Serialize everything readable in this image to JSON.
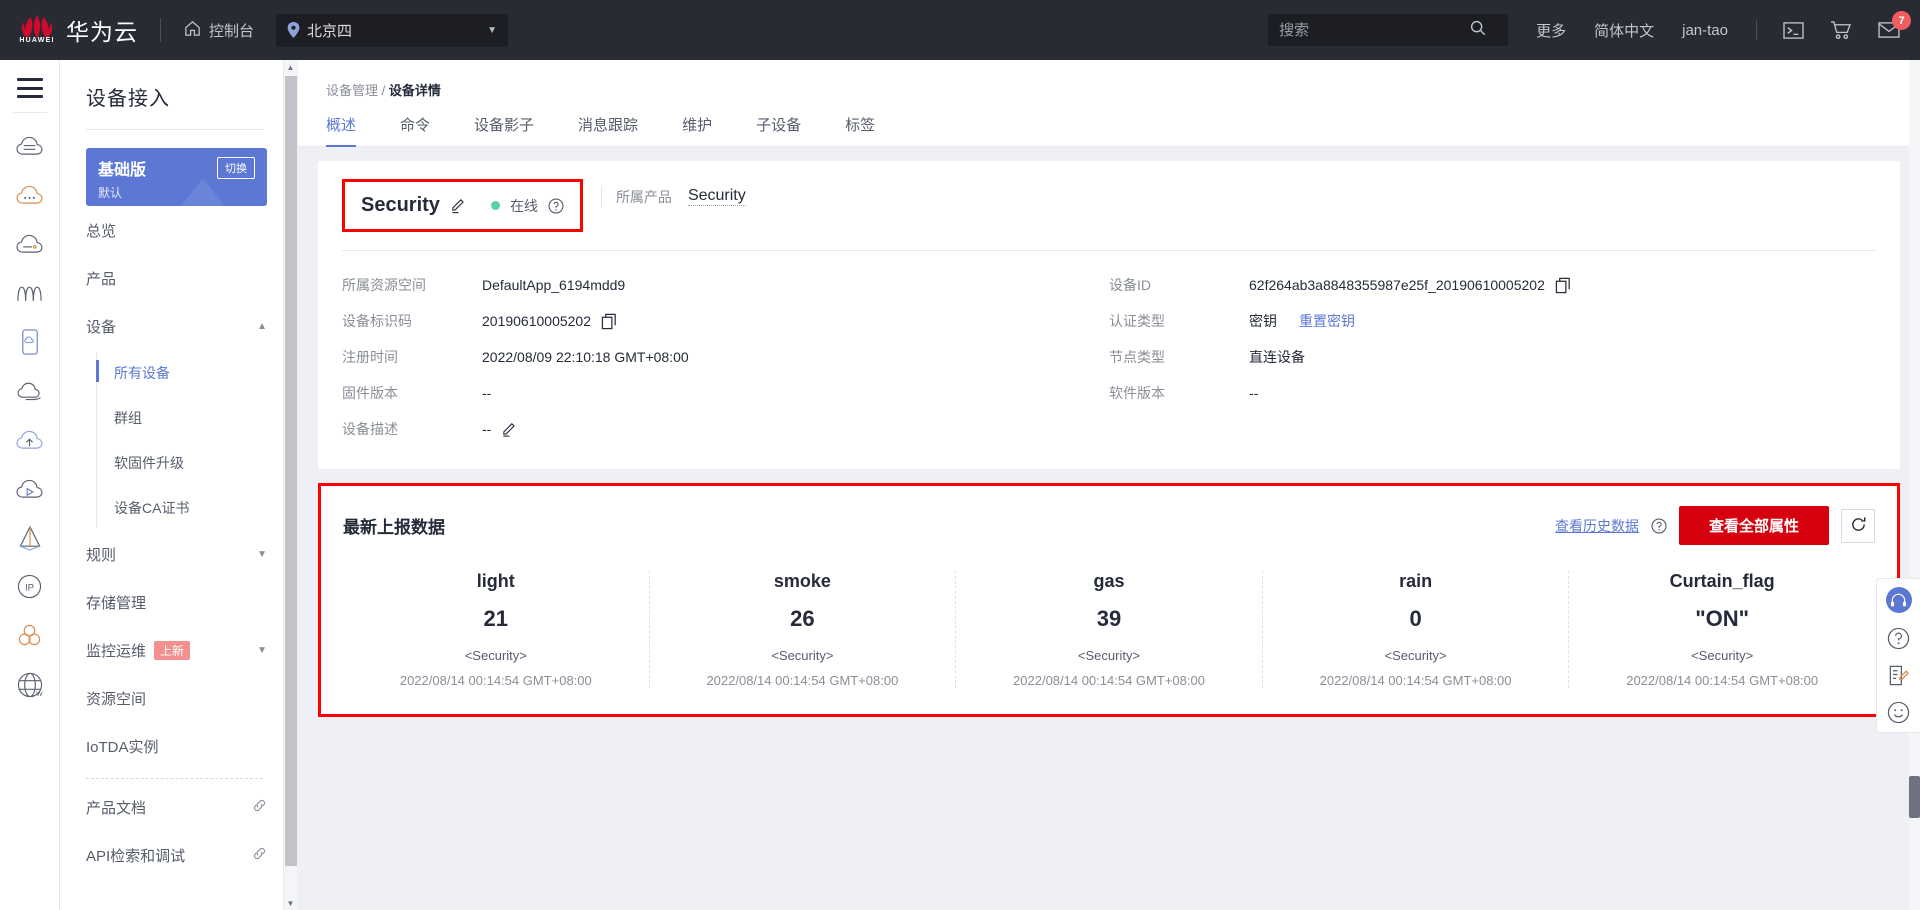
{
  "header": {
    "brand": "华为云",
    "brand_word": "HUAWEI",
    "console_label": "控制台",
    "home_icon": "home-icon",
    "region": "北京四",
    "region_icon": "location-pin-icon",
    "search_placeholder": "搜索",
    "search_value": "",
    "search_icon": "search-icon",
    "more_label": "更多",
    "lang_label": "简体中文",
    "user_label": "jan-tao",
    "terminal_icon": "terminal-icon",
    "cart_icon": "shopping-cart-icon",
    "mail_icon": "mail-icon",
    "mail_badge": "7"
  },
  "rail": {
    "menu_icon": "hamburger-menu-icon",
    "items": [
      {
        "icon": "cloud-server-icon"
      },
      {
        "icon": "cloud-dots-icon"
      },
      {
        "icon": "cloud-storage-icon"
      },
      {
        "icon": "wave-analytics-icon"
      },
      {
        "icon": "mobile-cloud-icon"
      },
      {
        "icon": "cloud-stack-icon"
      },
      {
        "icon": "cloud-upload-icon"
      },
      {
        "icon": "cloud-play-icon"
      },
      {
        "icon": "pyramid-icon"
      },
      {
        "icon": "ip-circle-icon"
      },
      {
        "icon": "cluster-nodes-icon"
      },
      {
        "icon": "globe-web-icon"
      }
    ]
  },
  "sidebar": {
    "title": "设备接入",
    "edition": {
      "name": "基础版",
      "switch_label": "切换",
      "sub": "默认"
    },
    "nav": [
      {
        "label": "总览",
        "type": "item"
      },
      {
        "label": "产品",
        "type": "item"
      },
      {
        "label": "设备",
        "type": "group",
        "expanded": true,
        "chevron": "chevron-up-icon"
      }
    ],
    "device_children": [
      {
        "label": "所有设备",
        "active": true
      },
      {
        "label": "群组",
        "active": false
      },
      {
        "label": "软固件升级",
        "active": false
      },
      {
        "label": "设备CA证书",
        "active": false
      }
    ],
    "nav2": [
      {
        "label": "规则",
        "type": "group",
        "chevron": "chevron-down-icon"
      },
      {
        "label": "存储管理",
        "type": "item"
      },
      {
        "label": "监控运维",
        "type": "group",
        "badge": "上新",
        "chevron": "chevron-down-icon"
      },
      {
        "label": "资源空间",
        "type": "item"
      },
      {
        "label": "IoTDA实例",
        "type": "item"
      }
    ],
    "external": [
      {
        "label": "产品文档",
        "icon": "external-link-icon"
      },
      {
        "label": "API检索和调试",
        "icon": "external-link-icon"
      }
    ],
    "scroll_up_icon": "scroll-up-arrow-icon",
    "scroll_down_icon": "scroll-down-arrow-icon"
  },
  "breadcrumb": {
    "parent": "设备管理",
    "separator": "/",
    "current": "设备详情"
  },
  "tabs": [
    {
      "label": "概述",
      "active": true
    },
    {
      "label": "命令",
      "active": false
    },
    {
      "label": "设备影子",
      "active": false
    },
    {
      "label": "消息跟踪",
      "active": false
    },
    {
      "label": "维护",
      "active": false
    },
    {
      "label": "子设备",
      "active": false
    },
    {
      "label": "标签",
      "active": false
    }
  ],
  "device": {
    "name": "Security",
    "edit_icon": "pencil-edit-icon",
    "status_text": "在线",
    "status_color": "#5ad2a4",
    "help_icon": "question-circle-icon",
    "product_label": "所属产品",
    "product_name": "Security",
    "highlight_color": "#fd0000",
    "left_fields": [
      {
        "key": "所属资源空间",
        "value": "DefaultApp_6194mdd9",
        "copy": false,
        "edit": false
      },
      {
        "key": "设备标识码",
        "value": "20190610005202",
        "copy": true,
        "edit": false
      },
      {
        "key": "注册时间",
        "value": "2022/08/09 22:10:18 GMT+08:00",
        "copy": false,
        "edit": false
      },
      {
        "key": "固件版本",
        "value": "--",
        "copy": false,
        "edit": false
      },
      {
        "key": "设备描述",
        "value": "--",
        "copy": false,
        "edit": true
      }
    ],
    "right_fields": [
      {
        "key": "设备ID",
        "value": "62f264ab3a8848355987e25f_20190610005202",
        "copy": true,
        "link": ""
      },
      {
        "key": "认证类型",
        "value": "密钥",
        "copy": false,
        "link": "重置密钥"
      },
      {
        "key": "节点类型",
        "value": "直连设备",
        "copy": false,
        "link": ""
      },
      {
        "key": "软件版本",
        "value": "--",
        "copy": false,
        "link": ""
      }
    ]
  },
  "data_card": {
    "title": "最新上报数据",
    "history_link": "查看历史数据",
    "help_icon": "question-circle-icon",
    "all_props_button": "查看全部属性",
    "refresh_icon": "refresh-icon",
    "button_color": "#d7000f",
    "metrics": [
      {
        "name": "light",
        "value": "21",
        "source": "<Security>",
        "time": "2022/08/14 00:14:54 GMT+08:00"
      },
      {
        "name": "smoke",
        "value": "26",
        "source": "<Security>",
        "time": "2022/08/14 00:14:54 GMT+08:00"
      },
      {
        "name": "gas",
        "value": "39",
        "source": "<Security>",
        "time": "2022/08/14 00:14:54 GMT+08:00"
      },
      {
        "name": "rain",
        "value": "0",
        "source": "<Security>",
        "time": "2022/08/14 00:14:54 GMT+08:00"
      },
      {
        "name": "Curtain_flag",
        "value": "\"ON\"",
        "source": "<Security>",
        "time": "2022/08/14 00:14:54 GMT+08:00"
      }
    ]
  },
  "float_panel": [
    {
      "icon": "headset-support-icon"
    },
    {
      "icon": "question-circle-icon"
    },
    {
      "icon": "feedback-form-icon"
    },
    {
      "icon": "smiley-face-icon"
    }
  ]
}
